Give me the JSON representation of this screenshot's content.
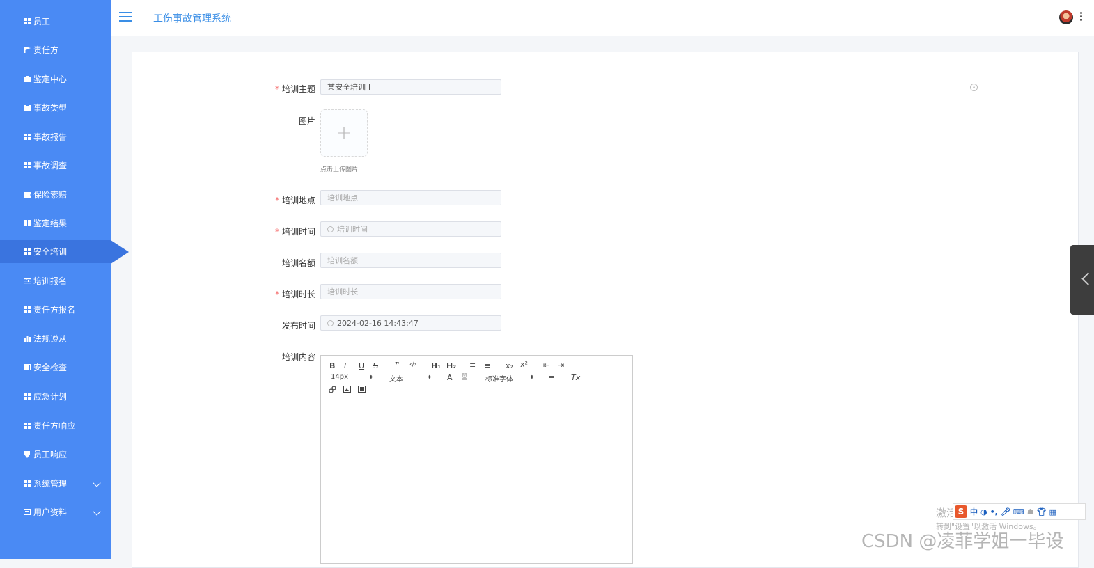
{
  "header": {
    "title": "工伤事故管理系统"
  },
  "sidebar": {
    "items": [
      {
        "label": "员工",
        "icon": "grid-icon"
      },
      {
        "label": "责任方",
        "icon": "flag-icon"
      },
      {
        "label": "鉴定中心",
        "icon": "briefcase-icon"
      },
      {
        "label": "事故类型",
        "icon": "clipboard-icon"
      },
      {
        "label": "事故报告",
        "icon": "grid-icon"
      },
      {
        "label": "事故调查",
        "icon": "grid-icon"
      },
      {
        "label": "保险索赔",
        "icon": "ticket-icon"
      },
      {
        "label": "鉴定结果",
        "icon": "grid-icon"
      },
      {
        "label": "安全培训",
        "icon": "grid-icon",
        "active": true
      },
      {
        "label": "培训报名",
        "icon": "sliders-icon"
      },
      {
        "label": "责任方报名",
        "icon": "grid-icon"
      },
      {
        "label": "法规遵从",
        "icon": "bar-chart-icon"
      },
      {
        "label": "安全检查",
        "icon": "book-icon"
      },
      {
        "label": "应急计划",
        "icon": "grid-icon"
      },
      {
        "label": "责任方响应",
        "icon": "grid-icon"
      },
      {
        "label": "员工响应",
        "icon": "shield-icon"
      },
      {
        "label": "系统管理",
        "icon": "grid-icon",
        "expandable": true
      },
      {
        "label": "用户资料",
        "icon": "id-card-icon",
        "expandable": true
      }
    ]
  },
  "form": {
    "topic": {
      "label": "培训主题",
      "value": "某安全培训",
      "required": true
    },
    "image": {
      "label": "图片",
      "hint": "点击上传图片"
    },
    "location": {
      "label": "培训地点",
      "placeholder": "培训地点",
      "required": true
    },
    "time": {
      "label": "培训时间",
      "placeholder": "培训时间",
      "required": true
    },
    "quota": {
      "label": "培训名额",
      "placeholder": "培训名额",
      "required": false
    },
    "duration": {
      "label": "培训时长",
      "placeholder": "培训时长",
      "required": true
    },
    "publish_time": {
      "label": "发布时间",
      "value": "2024-02-16 14:43:47"
    },
    "content": {
      "label": "培训内容"
    }
  },
  "editor": {
    "font_size": "14px",
    "paragraph": "文本",
    "font_family": "标准字体",
    "buttons": [
      "B",
      "I",
      "U",
      "S",
      "❞",
      "‹/›",
      "H₁",
      "H₂",
      "≡",
      "≣",
      "x₂",
      "x²",
      "⇤",
      "⇥",
      "A",
      "A",
      "≡",
      "Tx",
      "🔗",
      "▣",
      "▤"
    ]
  },
  "overlay": {
    "watermark": "CSDN @凌菲学姐一毕设",
    "activate_line1": "激活 Windows",
    "activate_line2": "转到\"设置\"以激活 Windows。",
    "ime_label": "中"
  },
  "colors": {
    "sidebar_bg": "#4a8af4",
    "sidebar_active": "#3a74df",
    "accent": "#3a8ee6",
    "required": "#f56c6c"
  }
}
